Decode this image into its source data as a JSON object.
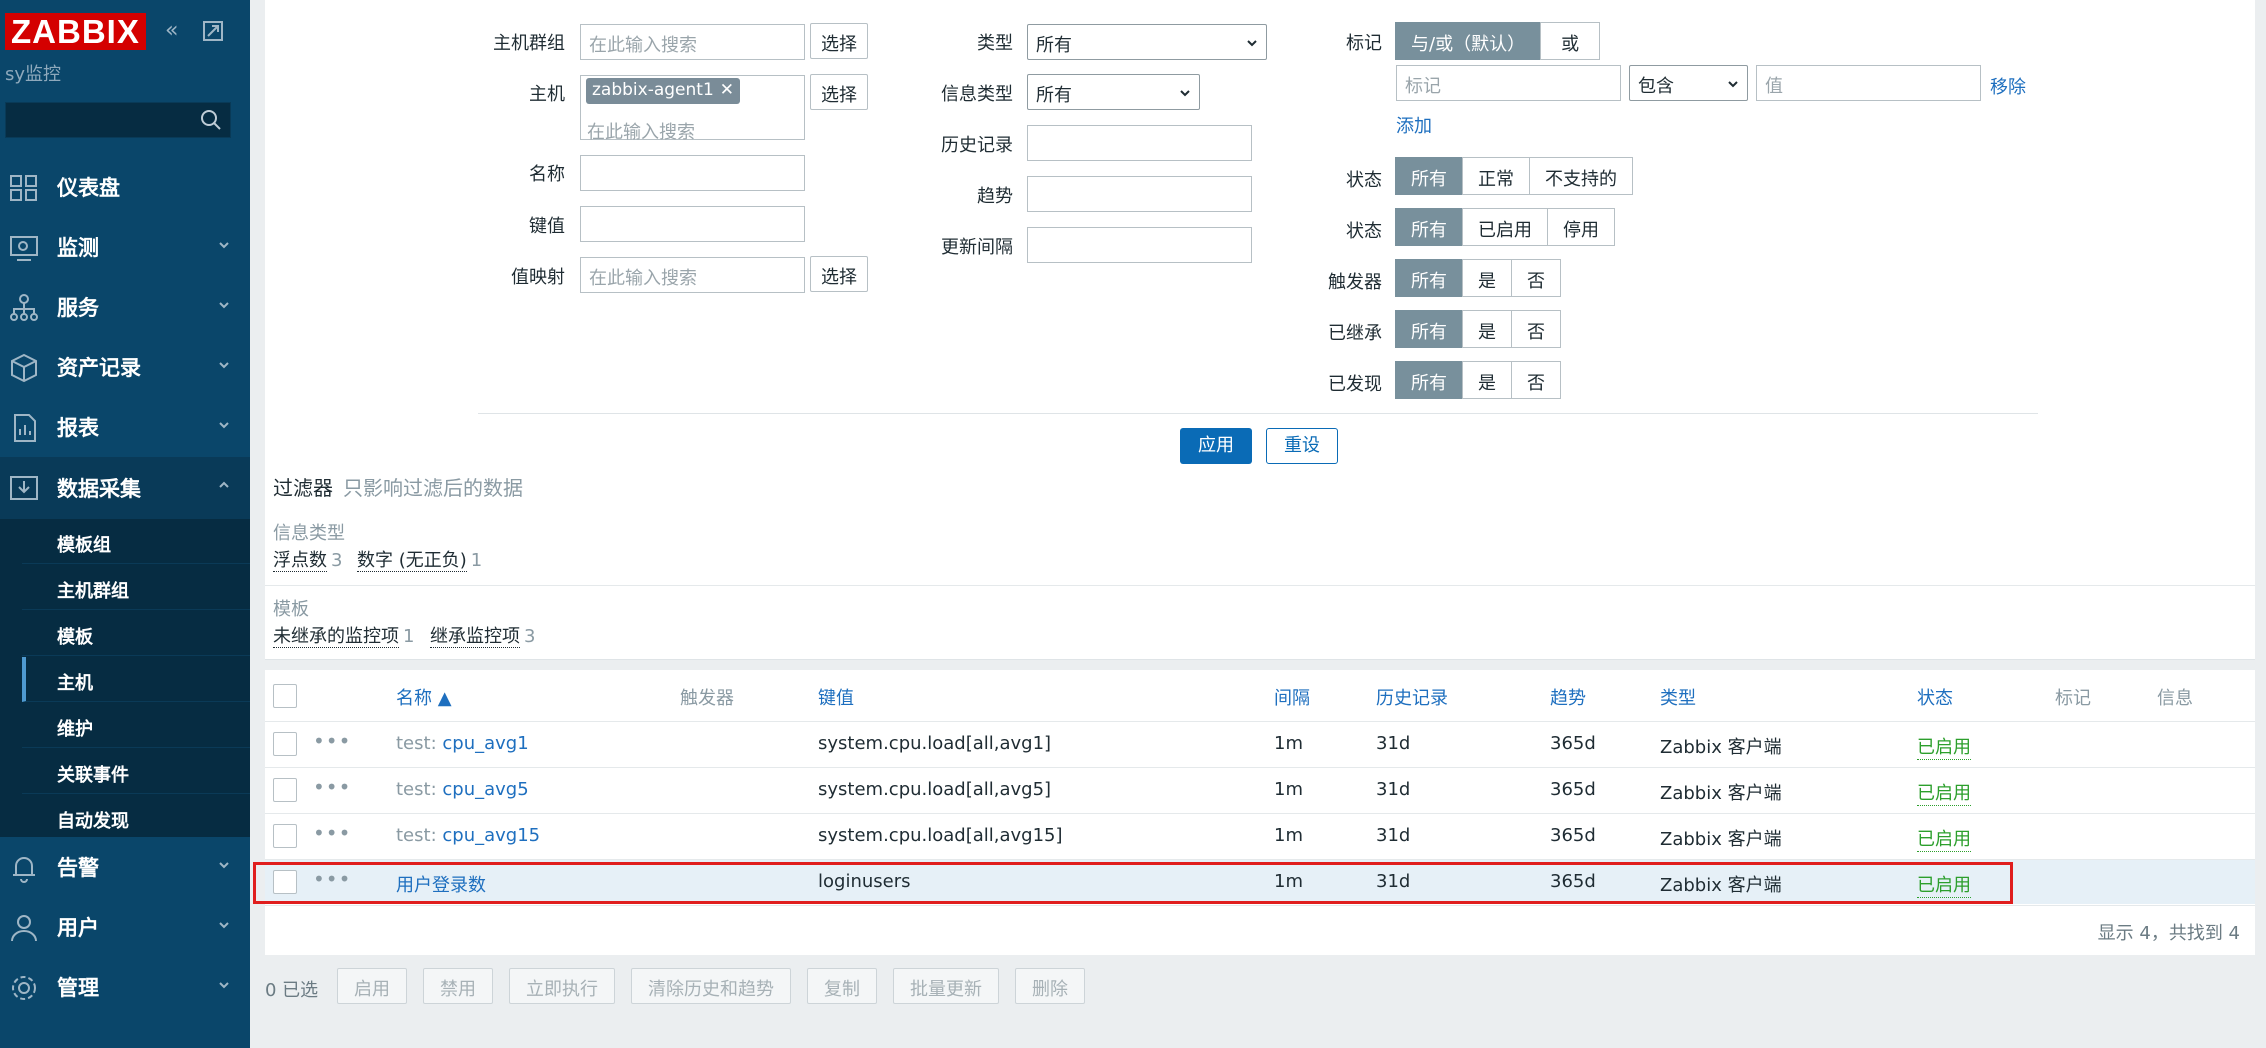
{
  "app": {
    "logo": "ZABBIX",
    "server_name": "sy监控"
  },
  "sidebar": {
    "menu": [
      {
        "label": "仪表盘",
        "icon": "dashboard-icon"
      },
      {
        "label": "监测",
        "icon": "monitoring-icon"
      },
      {
        "label": "服务",
        "icon": "services-icon"
      },
      {
        "label": "资产记录",
        "icon": "inventory-icon"
      },
      {
        "label": "报表",
        "icon": "reports-icon"
      },
      {
        "label": "数据采集",
        "icon": "data-collection-icon"
      },
      {
        "label": "告警",
        "icon": "alerts-icon"
      },
      {
        "label": "用户",
        "icon": "users-icon"
      },
      {
        "label": "管理",
        "icon": "administration-icon"
      }
    ],
    "submenu": [
      "模板组",
      "主机群组",
      "模板",
      "主机",
      "维护",
      "关联事件",
      "自动发现"
    ]
  },
  "filter": {
    "host_groups_label": "主机群组",
    "hosts_label": "主机",
    "name_label": "名称",
    "key_label": "键值",
    "valuemap_label": "值映射",
    "search_placeholder": "在此输入搜索",
    "select_btn": "选择",
    "host_chip": "zabbix-agent1",
    "chip_close": "✕",
    "type_label": "类型",
    "type_value": "所有",
    "info_type_label": "信息类型",
    "info_type_value": "所有",
    "history_label": "历史记录",
    "trends_label": "趋势",
    "interval_label": "更新间隔",
    "tags_label": "标记",
    "tags_andor": "与/或（默认）",
    "tags_or": "或",
    "tag_placeholder": "标记",
    "tag_op": "包含",
    "value_placeholder": "值",
    "remove_link": "移除",
    "add_link": "添加",
    "state_label": "状态",
    "state_opts": [
      "所有",
      "正常",
      "不支持的"
    ],
    "status_label": "状态",
    "status_opts": [
      "所有",
      "已启用",
      "停用"
    ],
    "triggers_label": "触发器",
    "triggers_opts": [
      "所有",
      "是",
      "否"
    ],
    "inherited_label": "已继承",
    "inherited_opts": [
      "所有",
      "是",
      "否"
    ],
    "discovered_label": "已发现",
    "discovered_opts": [
      "所有",
      "是",
      "否"
    ],
    "apply": "应用",
    "reset": "重设"
  },
  "summary": {
    "title": "过滤器",
    "subtitle": "只影响过滤后的数据",
    "info_type_label": "信息类型",
    "float": "浮点数",
    "float_n": "3",
    "unsigned": "数字 (无正负)",
    "unsigned_n": "1",
    "template_label": "模板",
    "not_inherited": "未继承的监控项",
    "not_inherited_n": "1",
    "inherited": "继承监控项",
    "inherited_n": "3"
  },
  "table": {
    "headers": {
      "name": "名称 ▲",
      "triggers": "触发器",
      "key": "键值",
      "interval": "间隔",
      "history": "历史记录",
      "trends": "趋势",
      "type": "类型",
      "status": "状态",
      "tags": "标记",
      "info": "信息"
    },
    "rows": [
      {
        "prefix": "test",
        "sep": ": ",
        "name": "cpu_avg1",
        "key": "system.cpu.load[all,avg1]",
        "interval": "1m",
        "history": "31d",
        "trends": "365d",
        "type": "Zabbix 客户端",
        "status": "已启用"
      },
      {
        "prefix": "test",
        "sep": ": ",
        "name": "cpu_avg5",
        "key": "system.cpu.load[all,avg5]",
        "interval": "1m",
        "history": "31d",
        "trends": "365d",
        "type": "Zabbix 客户端",
        "status": "已启用"
      },
      {
        "prefix": "test",
        "sep": ": ",
        "name": "cpu_avg15",
        "key": "system.cpu.load[all,avg15]",
        "interval": "1m",
        "history": "31d",
        "trends": "365d",
        "type": "Zabbix 客户端",
        "status": "已启用"
      },
      {
        "prefix": "",
        "sep": "",
        "name": "用户登录数",
        "key": "loginusers",
        "interval": "1m",
        "history": "31d",
        "trends": "365d",
        "type": "Zabbix 客户端",
        "status": "已启用"
      }
    ],
    "footer": "显示 4，共找到 4"
  },
  "actions": {
    "selected": "0 已选",
    "buttons": [
      "启用",
      "禁用",
      "立即执行",
      "清除历史和趋势",
      "复制",
      "批量更新",
      "删除"
    ]
  }
}
